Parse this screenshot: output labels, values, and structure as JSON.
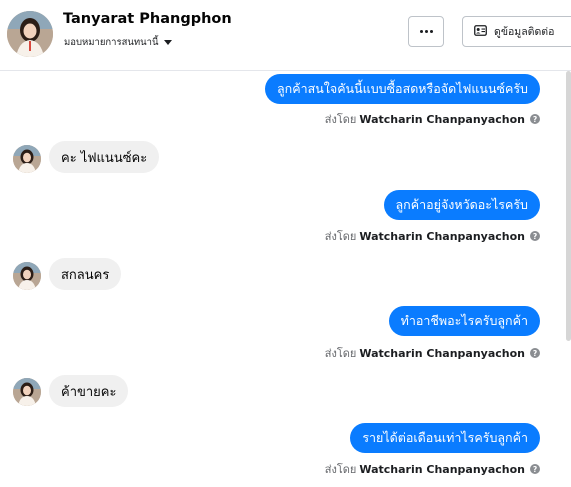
{
  "header": {
    "contact_name": "Tanyarat Phangphon",
    "assign_label": "มอบหมายการสนทนานี้",
    "more_label": "...",
    "detail_button_label": "ดูข้อมูลติดต่อ"
  },
  "messages": [
    {
      "direction": "out",
      "text": "ลูกค้าสนใจคันนี้แบบซื้อสดหรือจัดไฟแนนซ์ครับ",
      "sent_by_prefix": "ส่งโดย",
      "sender": "Watcharin Chanpanyachon"
    },
    {
      "direction": "in",
      "text": "คะ ไฟแนนซ์คะ"
    },
    {
      "direction": "out",
      "text": "ลูกค้าอยู่จังหวัดอะไรครับ",
      "sent_by_prefix": "ส่งโดย",
      "sender": "Watcharin Chanpanyachon"
    },
    {
      "direction": "in",
      "text": "สกลนคร"
    },
    {
      "direction": "out",
      "text": "ทำอาชีพอะไรครับลูกค้า",
      "sent_by_prefix": "ส่งโดย",
      "sender": "Watcharin Chanpanyachon"
    },
    {
      "direction": "in",
      "text": "ค้าขายคะ"
    },
    {
      "direction": "out",
      "text": "รายได้ต่อเดือนเท่าไรครับลูกค้า",
      "sent_by_prefix": "ส่งโดย",
      "sender": "Watcharin Chanpanyachon"
    }
  ],
  "colors": {
    "outgoing_bubble": "#0a7cff",
    "incoming_bubble": "#f0f0f0",
    "meta_text": "#65676b"
  }
}
